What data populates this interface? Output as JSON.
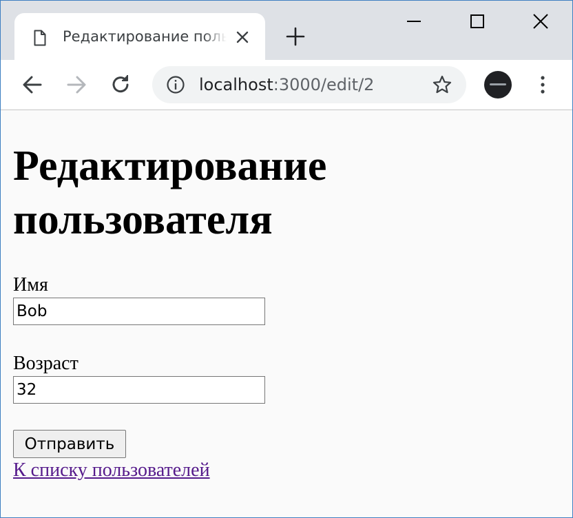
{
  "browser": {
    "tab_title": "Редактирование пользователя",
    "url_host": "localhost",
    "url_rest": ":3000/edit/2"
  },
  "icons": {
    "favicon": "page-icon",
    "close": "close-icon",
    "new_tab": "plus-icon",
    "minimize": "minimize-icon",
    "maximize": "maximize-icon",
    "window_close": "close-icon",
    "back": "arrow-left-icon",
    "forward": "arrow-right-icon",
    "reload": "reload-icon",
    "site_info": "info-icon",
    "bookmark": "star-icon",
    "profile": "avatar",
    "menu": "kebab-menu-icon"
  },
  "page": {
    "title": "Редактирование пользователя",
    "form": {
      "name_label": "Имя",
      "name_value": "Bob",
      "age_label": "Возраст",
      "age_value": "32",
      "submit_label": "Отправить"
    },
    "back_link": "К списку пользователей"
  },
  "colors": {
    "link_visited": "#551a8b",
    "tabstrip_bg": "#dee1e6",
    "window_border": "#3d7fc1"
  }
}
